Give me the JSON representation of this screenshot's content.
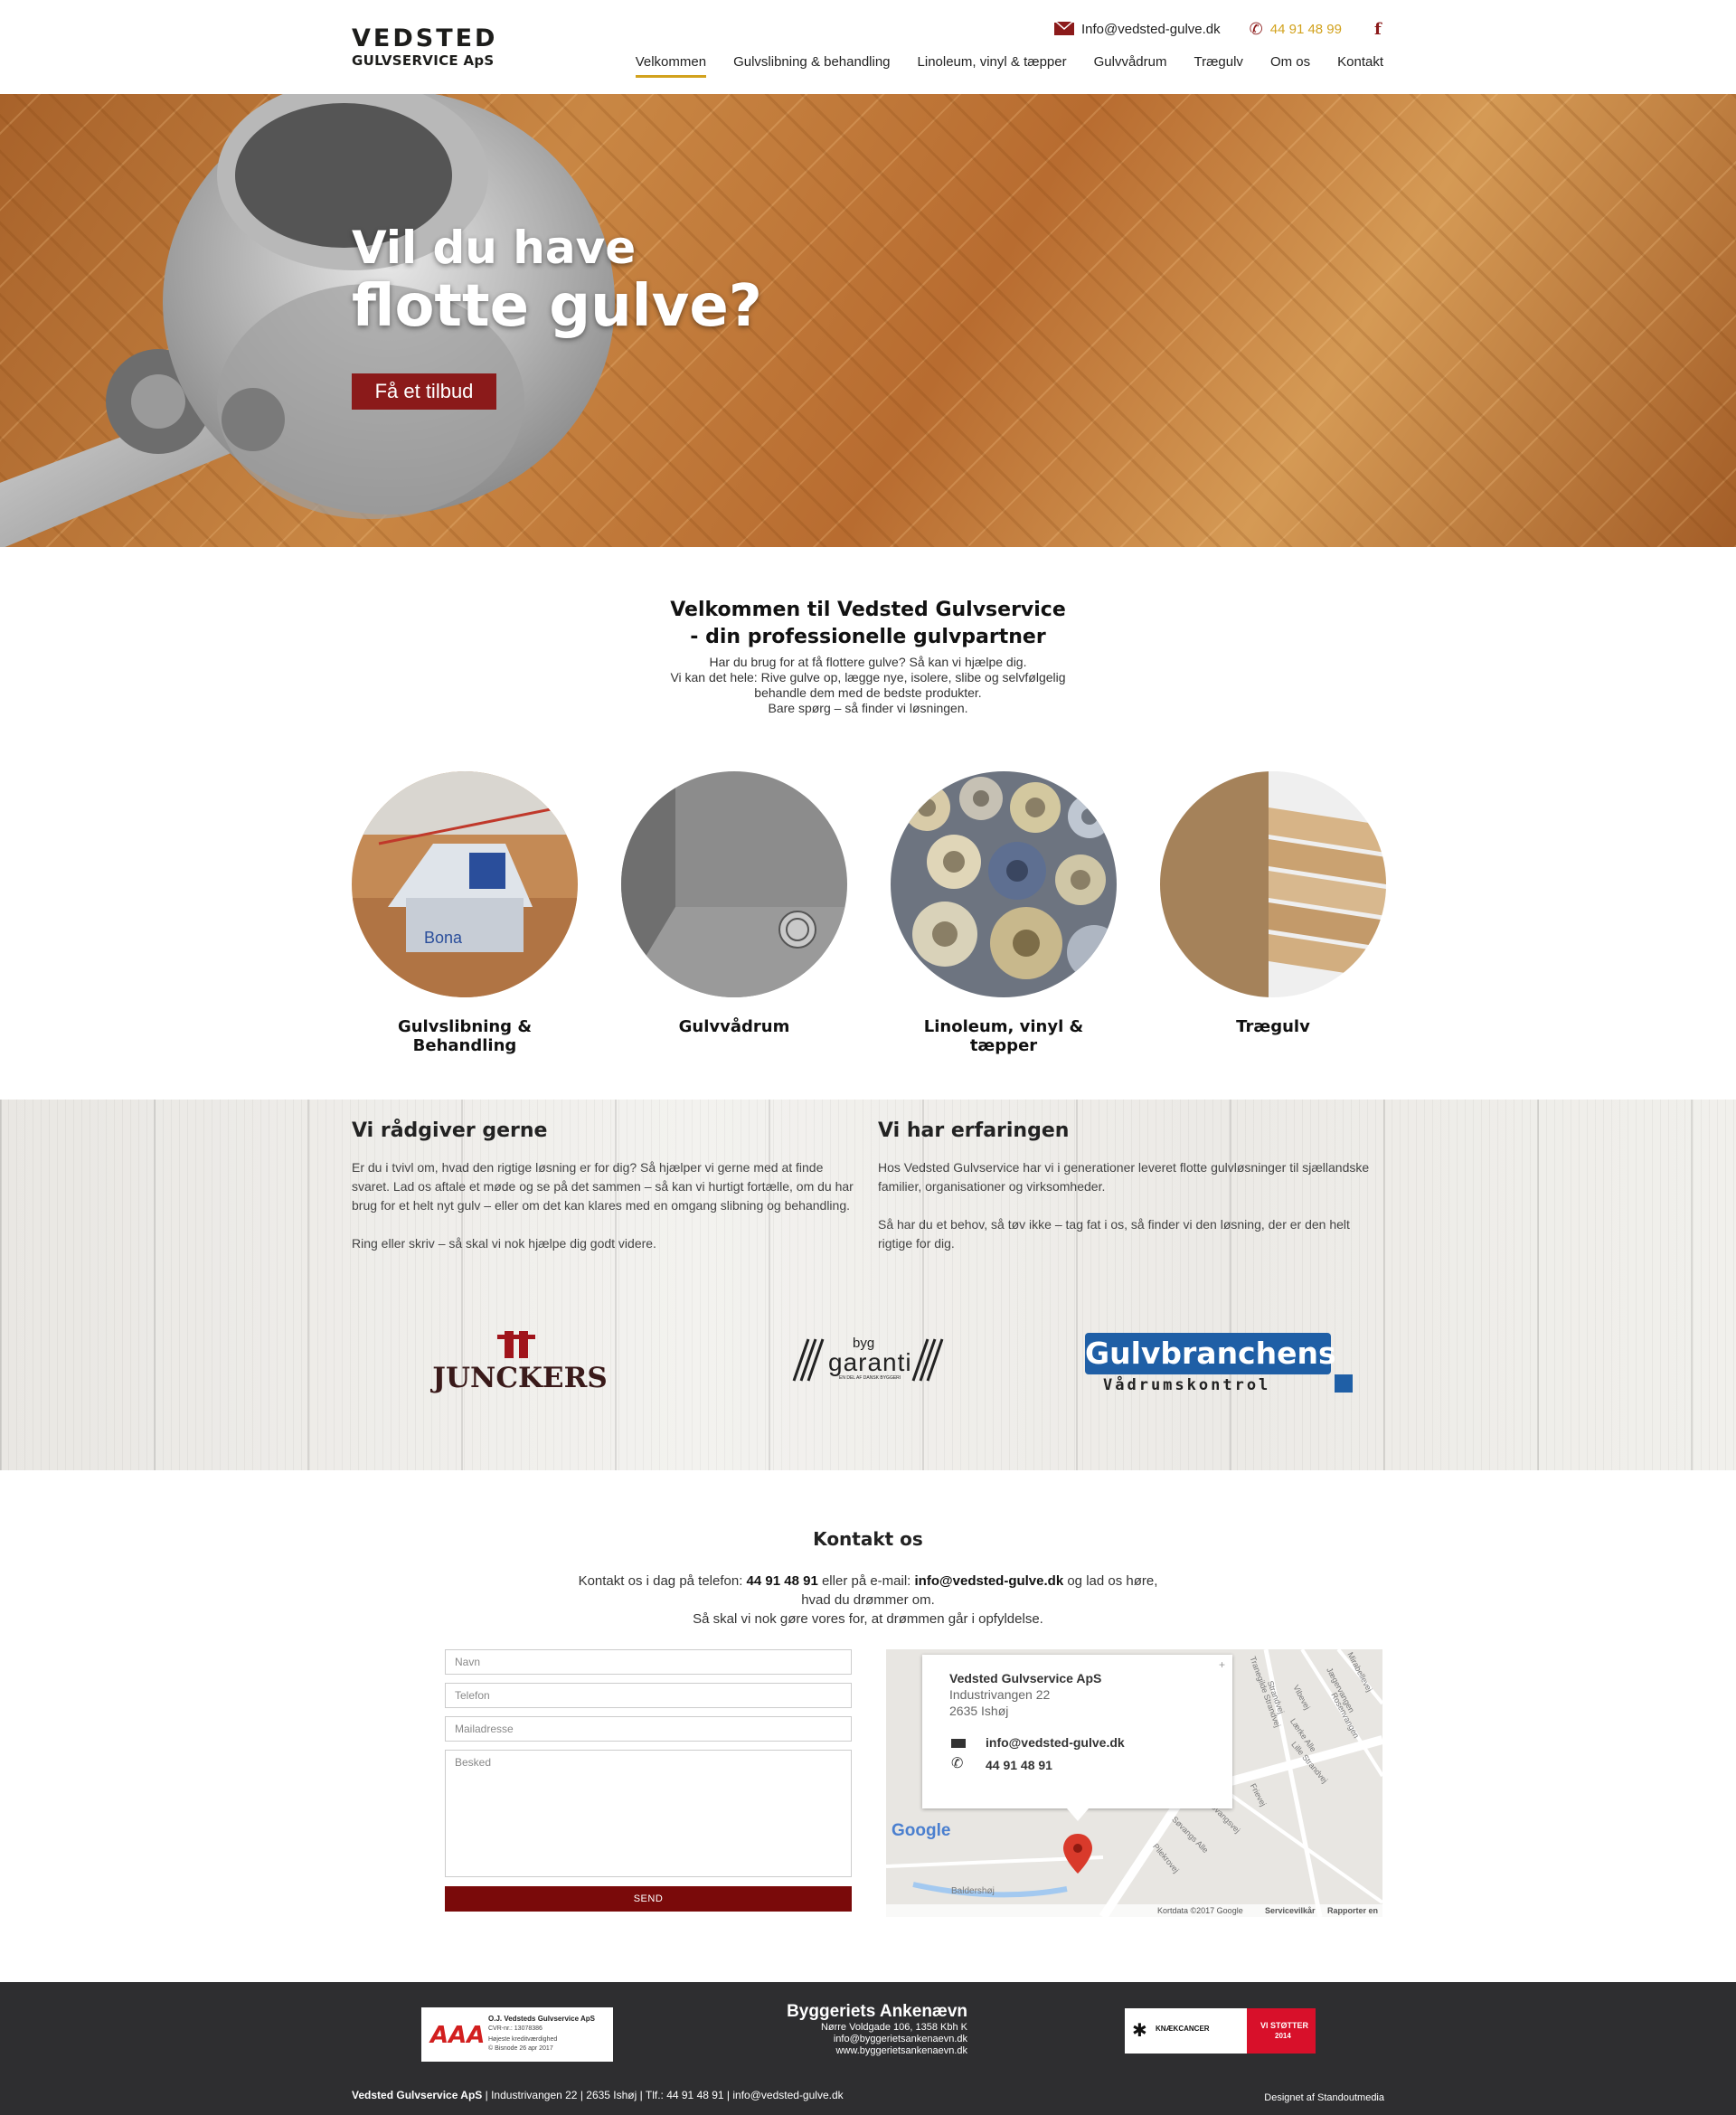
{
  "header": {
    "logo_line1": "VEDSTED",
    "logo_line2": "GULVSERVICE ApS",
    "email": "Info@vedsted-gulve.dk",
    "phone": "44 91 48 99",
    "facebook_icon": "f",
    "nav": [
      "Velkommen",
      "Gulvslibning & behandling",
      "Linoleum, vinyl & tæpper",
      "Gulvvådrum",
      "Trægulv",
      "Om os",
      "Kontakt"
    ]
  },
  "hero": {
    "title_line1": "Vil du have",
    "title_line2": "flotte gulve?",
    "cta": "Få et tilbud"
  },
  "intro": {
    "heading_line1": "Velkommen til Vedsted Gulvservice",
    "heading_line2": "- din professionelle gulvpartner",
    "p1": "Har du brug for at få flottere gulve? Så kan vi hjælpe dig.",
    "p2": "Vi kan det hele: Rive gulve op, lægge nye, isolere, slibe og selvfølgelig",
    "p3": "behandle dem med de bedste produkter.",
    "p4": "Bare spørg – så finder vi løsningen."
  },
  "services": [
    "Gulvslibning & Behandling",
    "Gulvvådrum",
    "Linoleum, vinyl & tæpper",
    "Trægulv"
  ],
  "advice": {
    "heading": "Vi rådgiver gerne",
    "p1": "Er du i tvivl om, hvad den rigtige løsning er for dig? Så hjælper vi gerne med at finde svaret. Lad os aftale et møde og se på det sammen – så kan vi hurtigt fortælle, om du har brug for et helt nyt gulv – eller om det kan klares med en omgang slibning og behandling.",
    "p2": "Ring eller skriv – så skal vi nok hjælpe dig godt videre."
  },
  "experience": {
    "heading": "Vi har erfaringen",
    "p1": "Hos Vedsted Gulvservice har vi i generationer leveret flotte gulvløsninger til sjællandske familier, organisationer og virksomheder.",
    "p2": "Så har du et behov, så tøv ikke – tag fat i os, så finder vi den løsning, der er den helt rigtige for dig."
  },
  "partners": {
    "junckers": "JUNCKERS",
    "byg_small": "byg",
    "byg_big": "garanti",
    "byg_tag": "EN DEL AF DANSK BYGGERI",
    "gulv_line1": "Gulvbranchens",
    "gulv_line2": "Vådrumskontrol"
  },
  "contact": {
    "heading": "Kontakt os",
    "line1_pre": "Kontakt os i dag på telefon: ",
    "line1_phone": "44 91 48 91",
    "line1_mid": " eller på e-mail: ",
    "line1_email": "info@vedsted-gulve.dk",
    "line1_post": " og lad os høre,",
    "line2": "hvad du drømmer om.",
    "line3": "Så skal vi nok gøre vores for, at drømmen går i opfyldelse.",
    "form": {
      "name": "Navn",
      "phone": "Telefon",
      "email": "Mailadresse",
      "message": "Besked",
      "send": "SEND"
    }
  },
  "map": {
    "company": "Vedsted Gulvservice ApS",
    "street": "Industrivangen 22",
    "city": "2635 Ishøj",
    "email": "info@vedsted-gulve.dk",
    "phone": "44 91 48 91",
    "google": "Google",
    "credits": "Kortdata ©2017 Google",
    "terms": "Servicevilkår",
    "report": "Rapporter en",
    "street_labels": [
      "Mirabellevej",
      "Jægervangen",
      "Rosenvangen",
      "Vibevej",
      "Lærke Alle",
      "Lille Strandvej",
      "Strandvej",
      "Frievej",
      "Tranegilde Strandvej",
      "Søvangsvej",
      "Søvangs Alle",
      "Pilekrovej",
      "Baldershøj"
    ]
  },
  "footer": {
    "aaa_company": "O.J. Vedsteds Gulvservice ApS",
    "aaa_cvr": "CVR-nr.: 13078386",
    "aaa_note1": "Højeste kreditværdighed",
    "aaa_note2": "© Bisnode 26 apr 2017",
    "ank_title": "Byggeriets Ankenævn",
    "ank_l1": "Nørre Voldgade 106, 1358 Kbh K",
    "ank_l2": "info@byggerietsankenaevn.dk",
    "ank_l3": "www.byggerietsankenaevn.dk",
    "knaek_text": "KNÆKCANCER",
    "knaek_support": "VI STØTTER",
    "knaek_year": "2014",
    "address_company": "Vedsted Gulvservice ApS",
    "address_rest": " | Industrivangen 22 | 2635 Ishøj | Tlf.: 44 91 48 91 | info@vedsted-gulve.dk",
    "designed_by": "Designet af Standoutmedia"
  }
}
